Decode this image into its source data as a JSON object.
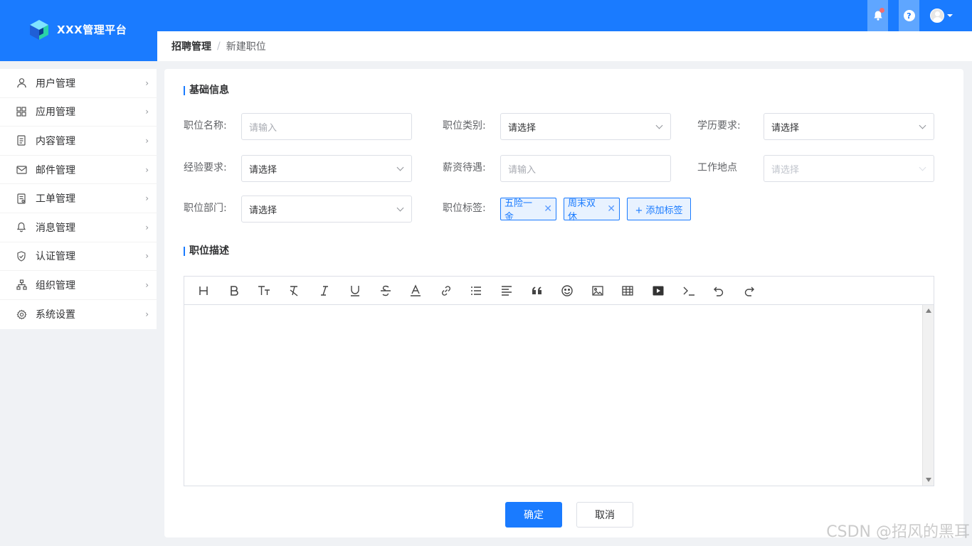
{
  "app": {
    "title": "XXX管理平台"
  },
  "header": {
    "notification_dot_color": "#f56c6c",
    "help_glyph": "?"
  },
  "breadcrumb": {
    "parent": "招聘管理",
    "separator": "/",
    "current": "新建职位"
  },
  "sidebar": {
    "items": [
      {
        "label": "用户管理",
        "icon": "user-icon"
      },
      {
        "label": "应用管理",
        "icon": "grid-icon"
      },
      {
        "label": "内容管理",
        "icon": "document-icon"
      },
      {
        "label": "邮件管理",
        "icon": "mail-icon"
      },
      {
        "label": "工单管理",
        "icon": "ticket-icon"
      },
      {
        "label": "消息管理",
        "icon": "bell-icon"
      },
      {
        "label": "认证管理",
        "icon": "shield-icon"
      },
      {
        "label": "组织管理",
        "icon": "org-chart-icon"
      },
      {
        "label": "系统设置",
        "icon": "gear-icon"
      }
    ]
  },
  "form": {
    "basic_section_title": "基础信息",
    "position_name": {
      "label": "职位名称:",
      "placeholder": "请输入"
    },
    "position_category": {
      "label": "职位类别:",
      "value": "请选择"
    },
    "education": {
      "label": "学历要求:",
      "value": "请选择"
    },
    "experience": {
      "label": "经验要求:",
      "value": "请选择"
    },
    "salary": {
      "label": "薪资待遇:",
      "placeholder": "请输入"
    },
    "work_location": {
      "label": "工作地点",
      "placeholder": "请选择"
    },
    "department": {
      "label": "职位部门:",
      "value": "请选择"
    },
    "tags": {
      "label": "职位标签:",
      "items": [
        "五险一金",
        "周末双休"
      ],
      "add_label": "+ 添加标签"
    },
    "description_section_title": "职位描述"
  },
  "editor": {
    "toolbar": [
      "heading-icon",
      "bold-icon",
      "font-size-icon",
      "clear-format-icon",
      "italic-icon",
      "underline-icon",
      "strikethrough-icon",
      "font-color-icon",
      "link-icon",
      "bullet-list-icon",
      "align-icon",
      "quote-icon",
      "emoji-icon",
      "image-icon",
      "table-icon",
      "video-icon",
      "code-icon",
      "undo-icon",
      "redo-icon"
    ]
  },
  "actions": {
    "confirm": "确定",
    "cancel": "取消"
  },
  "watermark": "CSDN @招风的黑耳",
  "colors": {
    "primary": "#1a7bff",
    "background": "#f0f2f5"
  }
}
